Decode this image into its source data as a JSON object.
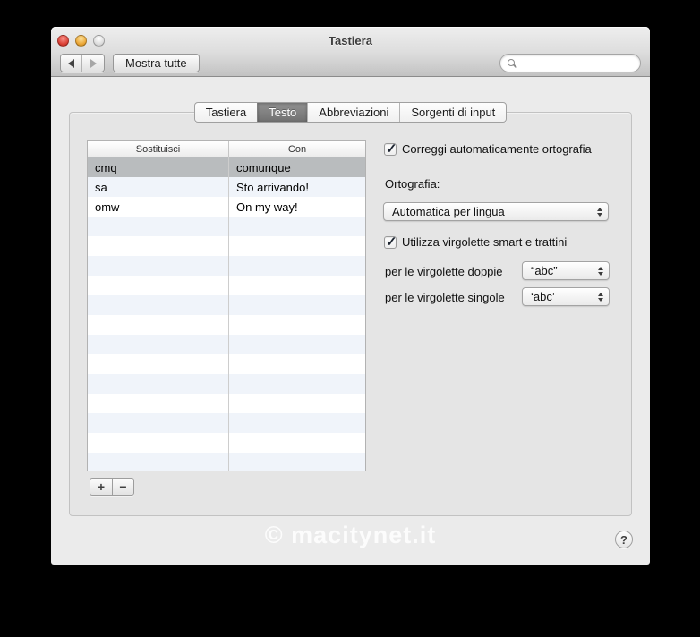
{
  "window": {
    "title": "Tastiera"
  },
  "toolbar": {
    "show_all_label": "Mostra tutte",
    "search_placeholder": ""
  },
  "tabs": {
    "items": [
      {
        "label": "Tastiera",
        "selected": false
      },
      {
        "label": "Testo",
        "selected": true
      },
      {
        "label": "Abbreviazioni",
        "selected": false
      },
      {
        "label": "Sorgenti di input",
        "selected": false
      }
    ]
  },
  "table": {
    "headers": [
      "Sostituisci",
      "Con"
    ],
    "rows": [
      {
        "replace": "cmq",
        "with": "comunque",
        "selected": true
      },
      {
        "replace": "sa",
        "with": "Sto arrivando!",
        "selected": false
      },
      {
        "replace": "omw",
        "with": "On my way!",
        "selected": false
      }
    ],
    "empty_rows": 13,
    "add_label": "+",
    "remove_label": "−"
  },
  "options": {
    "autocorrect_label": "Correggi automaticamente ortografia",
    "autocorrect_checked": true,
    "spelling_label": "Ortografia:",
    "spelling_value": "Automatica per lingua",
    "smart_quotes_label": "Utilizza virgolette smart e trattini",
    "smart_quotes_checked": true,
    "double_quotes_label": "per le virgolette doppie",
    "double_quotes_value": "“abc”",
    "single_quotes_label": "per le virgolette singole",
    "single_quotes_value": "‘abc’"
  },
  "footer": {
    "watermark": "© macitynet.it",
    "help_label": "?"
  },
  "colors": {
    "selection_gray": "#b9bcbe",
    "alt_row_blue": "#f0f4fa",
    "tab_selected_gray": "#7e7e7e",
    "traffic_red": "#dc4338",
    "traffic_yellow": "#eca839",
    "traffic_disabled": "#dddddd"
  }
}
